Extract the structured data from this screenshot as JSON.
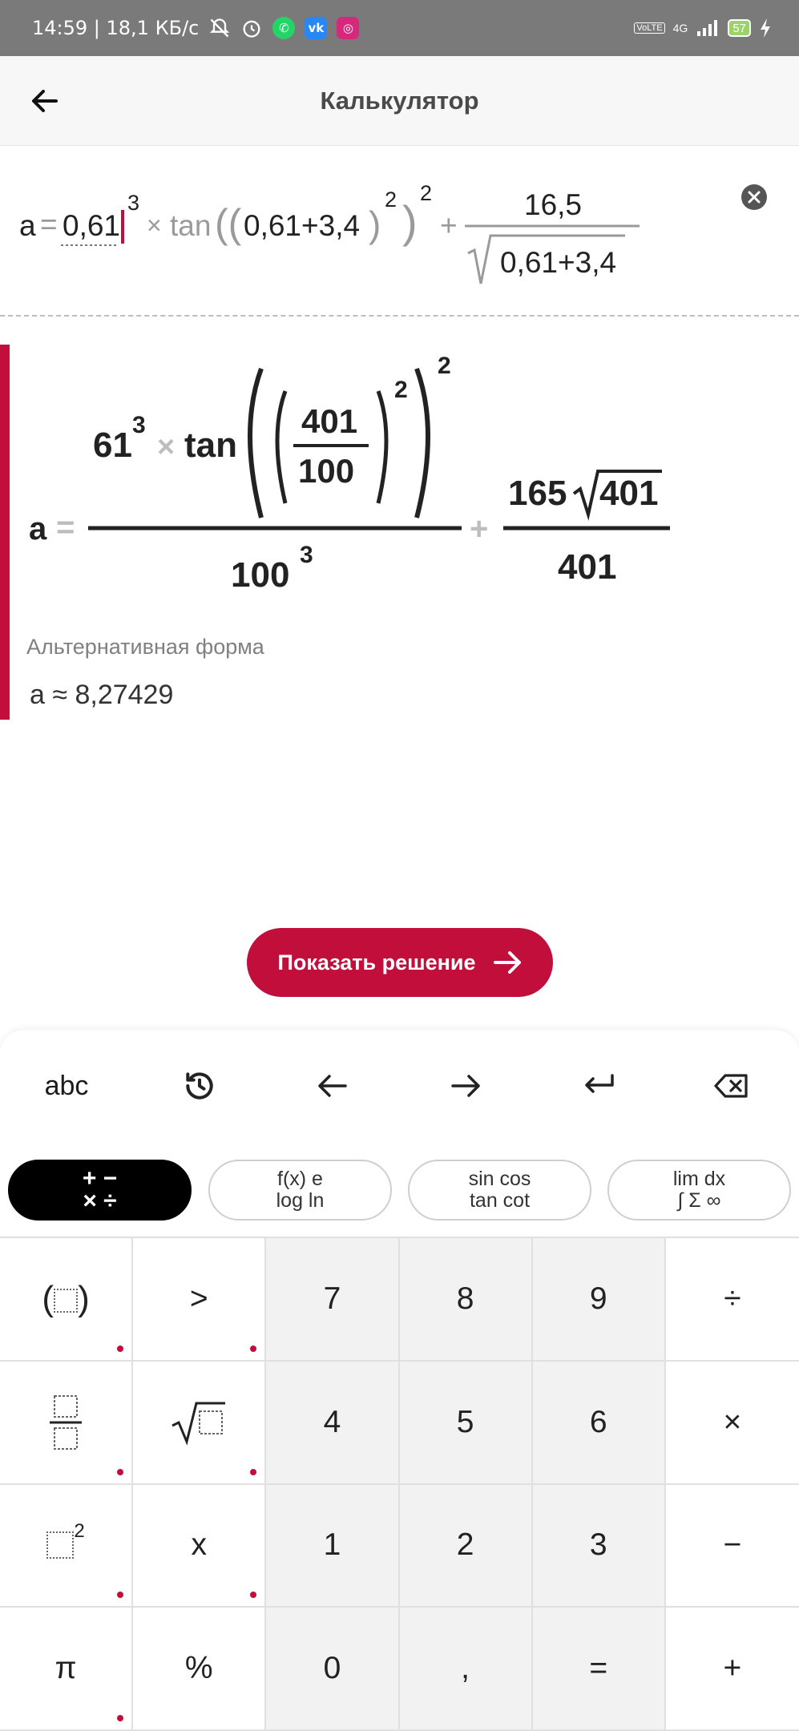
{
  "status_bar": {
    "time_speed": "14:59 | 18,1 КБ/с",
    "network": "4G",
    "battery": "57"
  },
  "header": {
    "title": "Калькулятор"
  },
  "input": {
    "lhs": "a",
    "equals": "=",
    "base": "0,61",
    "exp3": "3",
    "times": "×",
    "func": "tan",
    "open_parens": "((",
    "inner": "0,61+3,4",
    "close_paren": ")",
    "exp2_inner": "2",
    "close_paren2": ")",
    "exp2_outer": "2",
    "plus": "+",
    "frac_num": "16,5",
    "frac_den": "0,61+3,4"
  },
  "result": {
    "lhs": "a",
    "equals": "=",
    "num_base": "61",
    "num_exp": "3",
    "times": "×",
    "func": "tan",
    "inner_num": "401",
    "inner_den": "100",
    "inner_exp": "2",
    "outer_exp": "2",
    "den_base": "100",
    "den_exp": "3",
    "plus": "+",
    "frac2_coef": "165",
    "frac2_rad": "401",
    "frac2_den": "401"
  },
  "alternative": {
    "label": "Альтернативная форма",
    "value": "a ≈ 8,27429"
  },
  "solution_button": {
    "label": "Показать решение"
  },
  "tools": {
    "abc": "abc"
  },
  "chips": [
    {
      "l1": "+ −",
      "l2": "× ÷"
    },
    {
      "l1": "f(x)  e",
      "l2": "log  ln"
    },
    {
      "l1": "sin cos",
      "l2": "tan cot"
    },
    {
      "l1": "lim  dx",
      "l2": "∫ Σ ∞"
    }
  ],
  "keys": {
    "gt": ">",
    "k7": "7",
    "k8": "8",
    "k9": "9",
    "div": "÷",
    "k4": "4",
    "k5": "5",
    "k6": "6",
    "mul": "×",
    "x": "x",
    "k1": "1",
    "k2": "2",
    "k3": "3",
    "minus": "−",
    "pi": "π",
    "percent": "%",
    "k0": "0",
    "comma": ",",
    "eq": "=",
    "plus": "+",
    "sq_exp": "2"
  },
  "colors": {
    "accent": "#c20e3a",
    "status_bar": "#7a7a7a"
  }
}
